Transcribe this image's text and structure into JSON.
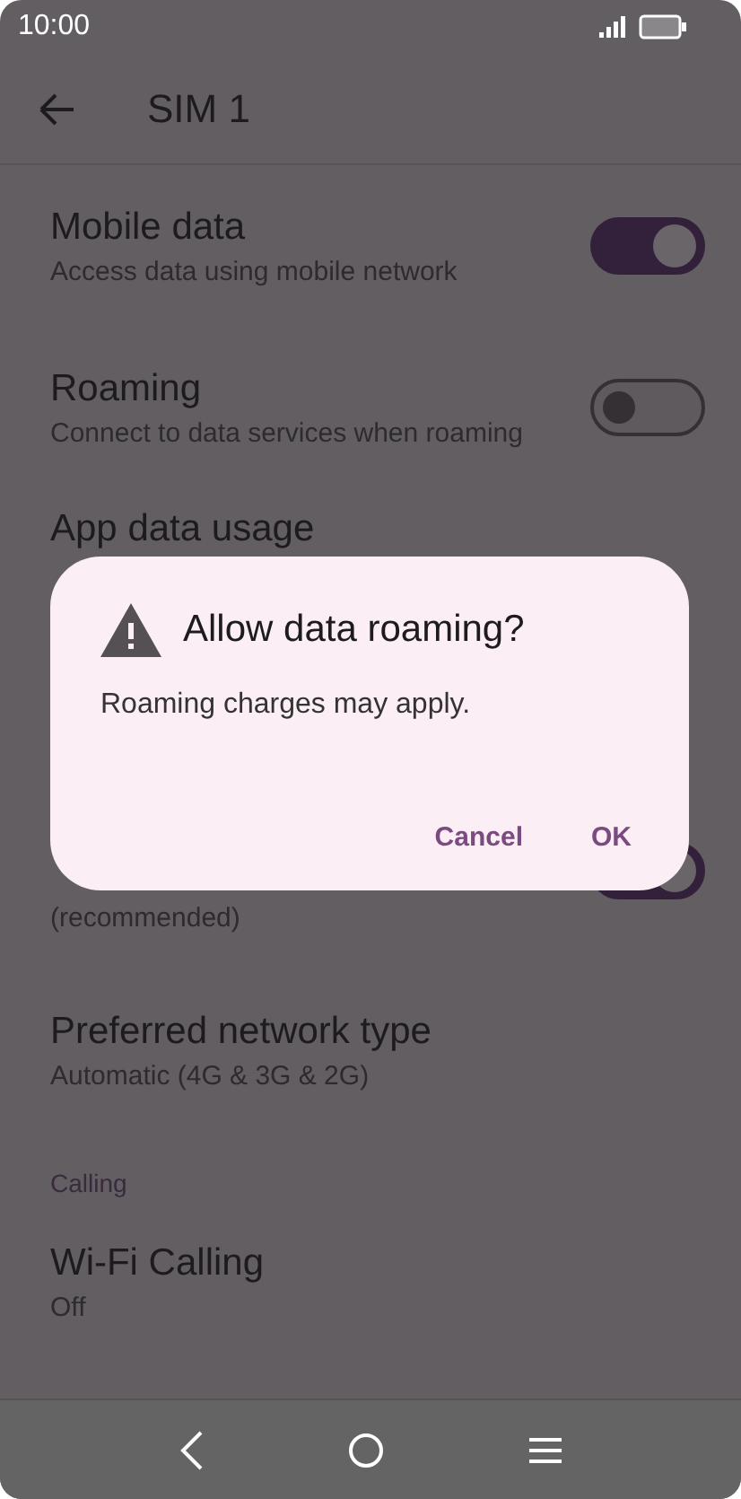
{
  "status_bar": {
    "time": "10:00"
  },
  "app_bar": {
    "title": "SIM 1"
  },
  "settings": [
    {
      "kind": "toggle",
      "title": "Mobile data",
      "subtitle": "Access data using mobile network",
      "on": true
    },
    {
      "kind": "toggle",
      "title": "Roaming",
      "subtitle": "Connect to data services when roaming",
      "on": false
    },
    {
      "kind": "link",
      "title": "App data usage"
    },
    {
      "kind": "toggle",
      "subtitle": "(recommended)",
      "on": true
    },
    {
      "kind": "link",
      "title": "Preferred network type",
      "subtitle": "Automatic (4G & 3G & 2G)"
    },
    {
      "kind": "header",
      "title": "Calling"
    },
    {
      "kind": "link",
      "title": "Wi-Fi Calling",
      "subtitle": "Off"
    }
  ],
  "dialog": {
    "title": "Allow data roaming?",
    "message": "Roaming charges may apply.",
    "buttons": [
      "Cancel",
      "OK"
    ]
  }
}
